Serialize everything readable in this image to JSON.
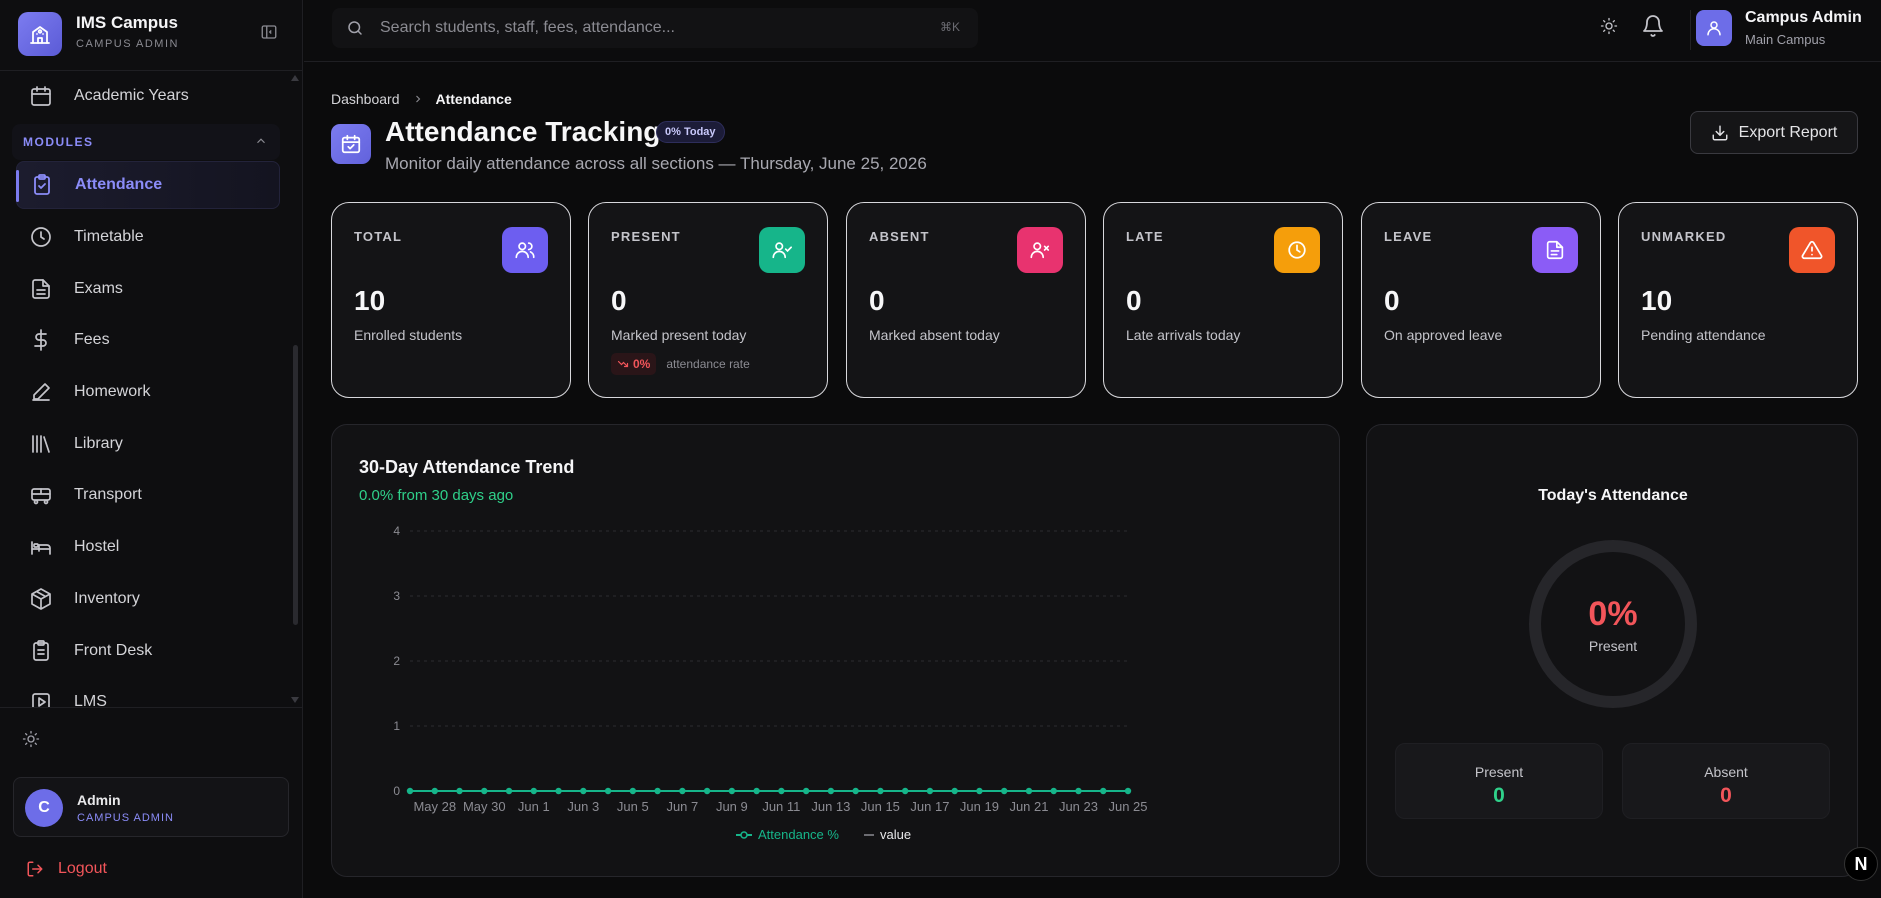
{
  "app": {
    "name": "IMS Campus",
    "role": "CAMPUS ADMIN"
  },
  "sidebar": {
    "items": [
      {
        "label": "Academic Years",
        "icon": "calendar-icon"
      },
      {
        "label": "Attendance",
        "icon": "clipboard-check-icon",
        "active": true
      },
      {
        "label": "Timetable",
        "icon": "clock-icon"
      },
      {
        "label": "Exams",
        "icon": "file-text-icon"
      },
      {
        "label": "Fees",
        "icon": "dollar-icon"
      },
      {
        "label": "Homework",
        "icon": "pen-icon"
      },
      {
        "label": "Library",
        "icon": "library-icon"
      },
      {
        "label": "Transport",
        "icon": "bus-icon"
      },
      {
        "label": "Hostel",
        "icon": "bed-icon"
      },
      {
        "label": "Inventory",
        "icon": "package-icon"
      },
      {
        "label": "Front Desk",
        "icon": "clipboard-list-icon"
      },
      {
        "label": "LMS",
        "icon": "play-square-icon"
      }
    ],
    "section": "MODULES",
    "user": {
      "initial": "C",
      "name": "Admin",
      "role": "CAMPUS ADMIN"
    },
    "logout": "Logout"
  },
  "topbar": {
    "search_placeholder": "Search students, staff, fees, attendance...",
    "shortcut": "⌘K",
    "user_name": "Campus Admin",
    "user_campus": "Main Campus"
  },
  "header": {
    "breadcrumbs": [
      "Dashboard",
      "Attendance"
    ],
    "title": "Attendance Tracking",
    "badge": "0% Today",
    "subtitle": "Monitor daily attendance across all sections — Thursday, June 25, 2026",
    "export_label": "Export Report"
  },
  "stats": [
    {
      "key": "TOTAL",
      "value": "10",
      "desc": "Enrolled students",
      "color": "#6d5ef0",
      "icon": "users-icon"
    },
    {
      "key": "PRESENT",
      "value": "0",
      "desc": "Marked present today",
      "color": "#16b58a",
      "icon": "user-check-icon",
      "rate": "0%",
      "rate_label": "attendance rate"
    },
    {
      "key": "ABSENT",
      "value": "0",
      "desc": "Marked absent today",
      "color": "#e8336f",
      "icon": "user-x-icon"
    },
    {
      "key": "LATE",
      "value": "0",
      "desc": "Late arrivals today",
      "color": "#f59e0b",
      "icon": "clock-icon"
    },
    {
      "key": "LEAVE",
      "value": "0",
      "desc": "On approved leave",
      "color": "#8b5cf6",
      "icon": "file-icon"
    },
    {
      "key": "UNMARKED",
      "value": "10",
      "desc": "Pending attendance",
      "color": "#f0552a",
      "icon": "alert-triangle-icon"
    }
  ],
  "trend": {
    "title": "30-Day Attendance Trend",
    "subtitle": "0.0% from 30 days ago"
  },
  "chart_data": {
    "type": "line",
    "title": "30-Day Attendance Trend",
    "x": [
      "May 27",
      "May 28",
      "May 29",
      "May 30",
      "May 31",
      "Jun 1",
      "Jun 2",
      "Jun 3",
      "Jun 4",
      "Jun 5",
      "Jun 6",
      "Jun 7",
      "Jun 8",
      "Jun 9",
      "Jun 10",
      "Jun 11",
      "Jun 12",
      "Jun 13",
      "Jun 14",
      "Jun 15",
      "Jun 16",
      "Jun 17",
      "Jun 18",
      "Jun 19",
      "Jun 20",
      "Jun 21",
      "Jun 22",
      "Jun 23",
      "Jun 24",
      "Jun 25"
    ],
    "x_tick_labels": [
      "May 28",
      "May 30",
      "Jun 1",
      "Jun 3",
      "Jun 5",
      "Jun 7",
      "Jun 9",
      "Jun 11",
      "Jun 13",
      "Jun 15",
      "Jun 17",
      "Jun 19",
      "Jun 21",
      "Jun 23",
      "Jun 25"
    ],
    "series": [
      {
        "name": "Attendance %",
        "values": [
          0,
          0,
          0,
          0,
          0,
          0,
          0,
          0,
          0,
          0,
          0,
          0,
          0,
          0,
          0,
          0,
          0,
          0,
          0,
          0,
          0,
          0,
          0,
          0,
          0,
          0,
          0,
          0,
          0,
          0
        ],
        "color": "#16b58a"
      },
      {
        "name": "value",
        "values": [],
        "color": "#8b8b92"
      }
    ],
    "ylim": [
      0,
      4
    ],
    "y_ticks": [
      0,
      1,
      2,
      3,
      4
    ],
    "grid": true,
    "legend": "bottom-center"
  },
  "today": {
    "title": "Today's Attendance",
    "percent": "0%",
    "percent_label": "Present",
    "present_label": "Present",
    "present_value": "0",
    "absent_label": "Absent",
    "absent_value": "0"
  },
  "badge_letter": "N"
}
